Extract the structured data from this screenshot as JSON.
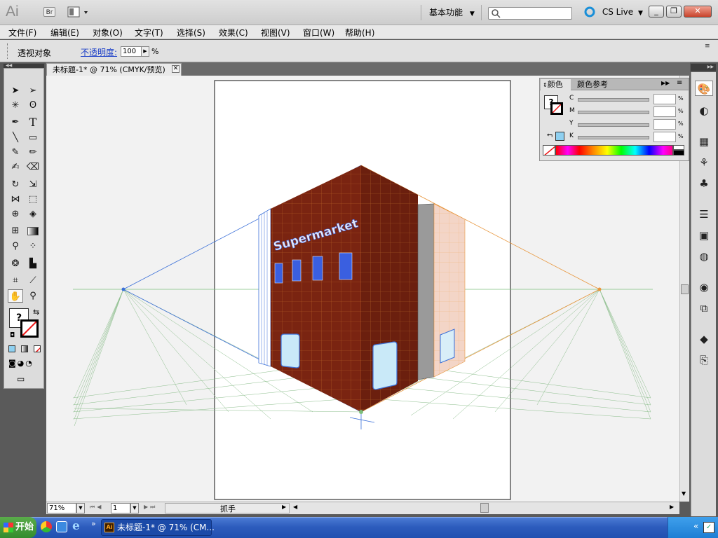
{
  "app": {
    "logo": "Ai",
    "bridge_label": "Br",
    "workspace": "基本功能",
    "cs_live": "CS Live",
    "search_placeholder": ""
  },
  "menu": [
    "文件(F)",
    "编辑(E)",
    "对象(O)",
    "文字(T)",
    "选择(S)",
    "效果(C)",
    "视图(V)",
    "窗口(W)",
    "帮助(H)"
  ],
  "control_bar": {
    "selection_label": "透视对象",
    "opacity_label": "不透明度:",
    "opacity_value": "100",
    "opacity_unit": "%"
  },
  "document": {
    "tab_title": "未标题-1* @ 71% (CMYK/预览)",
    "artwork_text": "Supermarket"
  },
  "color_panel": {
    "tab_color": "颜色",
    "tab_guide": "颜色参考",
    "channels": [
      {
        "label": "C",
        "value": "",
        "unit": "%"
      },
      {
        "label": "M",
        "value": "",
        "unit": "%"
      },
      {
        "label": "Y",
        "value": "",
        "unit": "%"
      },
      {
        "label": "K",
        "value": "",
        "unit": "%"
      }
    ]
  },
  "status_bar": {
    "zoom": "71%",
    "page": "1",
    "status_text": "抓手"
  },
  "taskbar": {
    "start_label": "开始",
    "task_label": "未标题-1* @ 71% (CM..."
  },
  "colors": {
    "building_dark": "#7a2411",
    "building_mid": "#6b1f0e",
    "grid_orange": "#e8963c",
    "grid_blue": "#3a6fd8",
    "grid_green": "#8bbd8b",
    "window_blue": "#3a5fe0",
    "panel_bg": "#e3e3e3",
    "taskbar_blue": "#2d5cbd"
  }
}
